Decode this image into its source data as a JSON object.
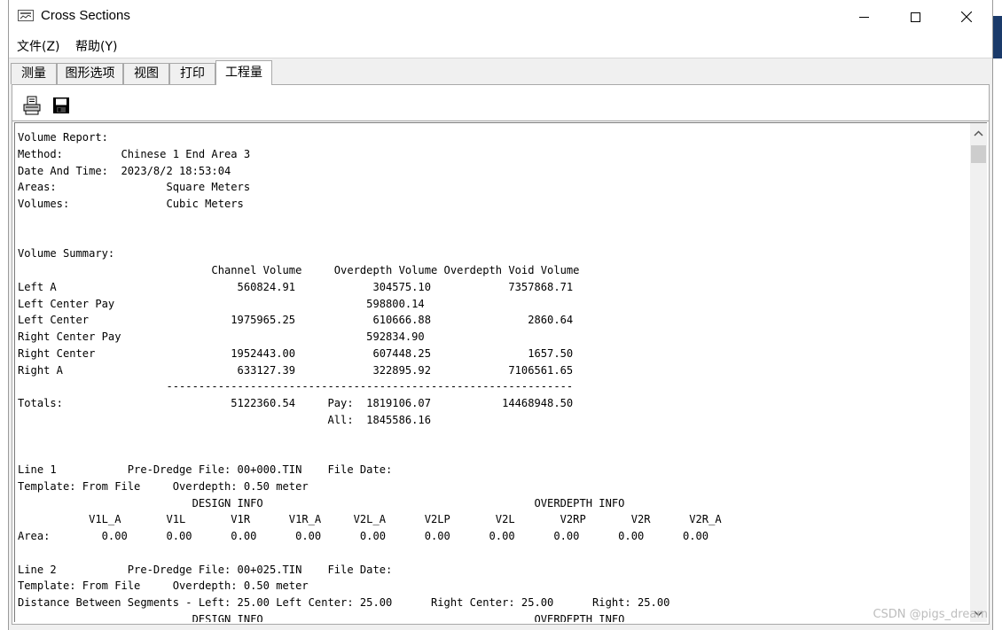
{
  "window": {
    "title": "Cross Sections"
  },
  "menu": {
    "items": [
      "文件(Z)",
      "帮助(Y)"
    ]
  },
  "tabs": [
    "测量",
    "图形选项",
    "视图",
    "打印",
    "工程量"
  ],
  "active_tab": "工程量",
  "toolbar": {
    "print_icon": "printer-icon",
    "save_icon": "floppy-disk-icon"
  },
  "report_lines": [
    "Volume Report:",
    "Method:         Chinese 1 End Area 3",
    "Date And Time:  2023/8/2 18:53:04",
    "Areas:                 Square Meters",
    "Volumes:               Cubic Meters",
    "",
    "",
    "Volume Summary:",
    "                              Channel Volume     Overdepth Volume Overdepth Void Volume",
    "Left A                            560824.91            304575.10            7357868.71",
    "Left Center Pay                                       598800.14",
    "Left Center                      1975965.25            610666.88               2860.64",
    "Right Center Pay                                      592834.90",
    "Right Center                     1952443.00            607448.25               1657.50",
    "Right A                           633127.39            322895.92            7106561.65",
    "                       ---------------------------------------------------------------",
    "Totals:                          5122360.54     Pay:  1819106.07           14468948.50",
    "                                                All:  1845586.16",
    "",
    "",
    "Line 1           Pre-Dredge File: 00+000.TIN    File Date:",
    "Template: From File     Overdepth: 0.50 meter",
    "                           DESIGN INFO                                          OVERDEPTH INFO",
    "           V1L_A       V1L       V1R      V1R_A     V2L_A      V2LP       V2L       V2RP       V2R      V2R_A",
    "Area:        0.00      0.00      0.00      0.00      0.00      0.00      0.00      0.00      0.00      0.00",
    "",
    "Line 2           Pre-Dredge File: 00+025.TIN    File Date:",
    "Template: From File     Overdepth: 0.50 meter",
    "Distance Between Segments - Left: 25.00 Left Center: 25.00      Right Center: 25.00      Right: 25.00",
    "                           DESIGN INFO                                          OVERDEPTH INFO"
  ],
  "watermark": "CSDN @pigs_dream"
}
